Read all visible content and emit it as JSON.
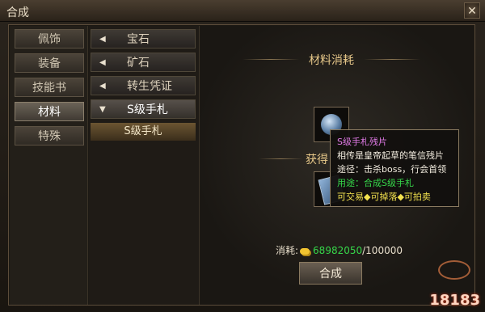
{
  "window": {
    "title": "合成",
    "close_glyph": "✕"
  },
  "categories": [
    {
      "label": "佩饰",
      "active": false
    },
    {
      "label": "装备",
      "active": false
    },
    {
      "label": "技能书",
      "active": false
    },
    {
      "label": "材料",
      "active": true
    },
    {
      "label": "特殊",
      "active": false
    }
  ],
  "items": [
    {
      "label": "宝石",
      "arrow": "◀"
    },
    {
      "label": "矿石",
      "arrow": "◀"
    },
    {
      "label": "转生凭证",
      "arrow": "◀"
    },
    {
      "label": "S级手札",
      "arrow": "▼"
    }
  ],
  "subitem": "S级手札",
  "sections": {
    "materials": "材料消耗",
    "obtain": "获得"
  },
  "tooltip": {
    "name": "S级手札残片",
    "desc": "相传是皇帝起草的笔信残片",
    "source": "途径：击杀boss，行会首领",
    "use": "用途：合成S级手札",
    "flags": "可交易◆可掉落◆可拍卖"
  },
  "cost": {
    "label": "消耗:",
    "have": "68982050",
    "need": "/100000"
  },
  "craft_button": "合成",
  "watermark": "18183",
  "colors": {
    "accent": "#e8c98a",
    "tooltip_name": "#e07ae6",
    "ok": "#36d84a",
    "flags": "#f3e24e"
  }
}
